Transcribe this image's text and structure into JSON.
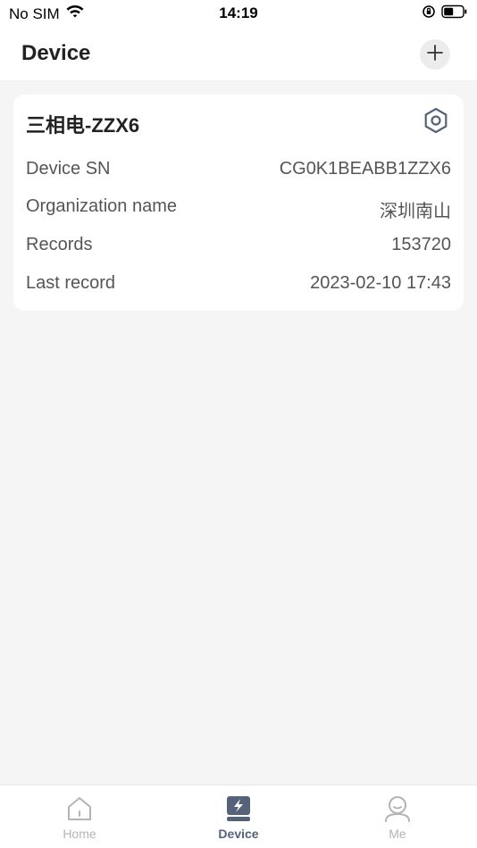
{
  "status_bar": {
    "carrier": "No SIM",
    "time": "14:19"
  },
  "header": {
    "title": "Device",
    "add_icon": "plus-icon"
  },
  "device_card": {
    "name": "三相电-ZZX6",
    "settings_icon": "gear-icon",
    "rows": [
      {
        "label": "Device SN",
        "value": "CG0K1BEABB1ZZX6"
      },
      {
        "label": "Organization name",
        "value": "深圳南山"
      },
      {
        "label": "Records",
        "value": "153720"
      },
      {
        "label": "Last record",
        "value": "2023-02-10 17:43"
      }
    ]
  },
  "tab_bar": {
    "tabs": [
      {
        "label": "Home",
        "icon": "home-icon",
        "active": false
      },
      {
        "label": "Device",
        "icon": "device-icon",
        "active": true
      },
      {
        "label": "Me",
        "icon": "user-icon",
        "active": false
      }
    ]
  },
  "colors": {
    "accent": "#56627a",
    "inactive": "#b4b4b4",
    "background": "#f5f5f5",
    "card": "#ffffff"
  }
}
